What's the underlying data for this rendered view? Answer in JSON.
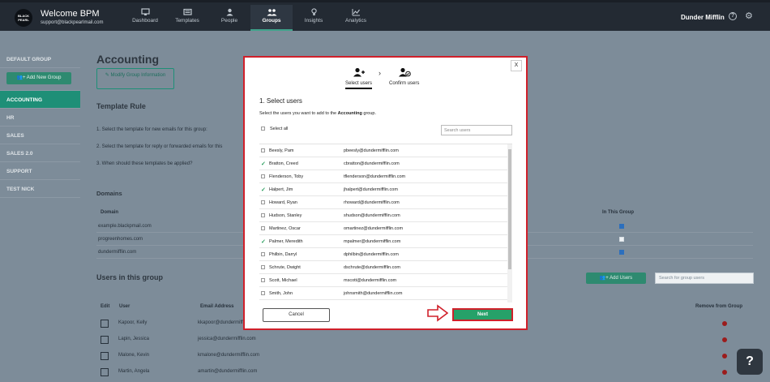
{
  "app": {
    "logo_text": "BLACK PEARL",
    "title": "Welcome BPM",
    "email": "support@blackpearlmail.com",
    "company": "Dunder Mifflin"
  },
  "nav": [
    {
      "label": "Dashboard",
      "icon": "monitor-icon",
      "active": false
    },
    {
      "label": "Templates",
      "icon": "templates-icon",
      "active": false
    },
    {
      "label": "People",
      "icon": "person-icon",
      "active": false
    },
    {
      "label": "Groups",
      "icon": "groups-icon",
      "active": true
    },
    {
      "label": "Insights",
      "icon": "lightbulb-icon",
      "active": false
    },
    {
      "label": "Analytics",
      "icon": "chart-icon",
      "active": false
    }
  ],
  "sidebar": {
    "default_group": "DEFAULT GROUP",
    "add_group": "Add New Group",
    "items": [
      "ACCOUNTING",
      "HR",
      "SALES",
      "SALES 2.0",
      "SUPPORT",
      "TEST NICK"
    ]
  },
  "background": {
    "title": "Accounting",
    "modify_button": "Modify Group Information",
    "template_rule": "Template Rule",
    "rule1": "1. Select the template for new emails for this group:",
    "rule2": "2. Select the template for reply or forwarded emails for this",
    "rule3": "3. When should these templates be applied?",
    "domains_heading": "Domains",
    "domain_col": "Domain",
    "in_group_col": "In This Group",
    "domains": [
      {
        "name": "example.blackpmail.com",
        "checked": true
      },
      {
        "name": "progreenhomes.com",
        "checked": false
      },
      {
        "name": "dundermifflin.com",
        "checked": true
      }
    ],
    "users_heading": "Users in this group",
    "add_users": "Add Users",
    "search_placeholder": "Search for group users",
    "col_edit": "Edit",
    "col_user": "User",
    "col_email": "Email Address",
    "col_remove": "Remove from Group",
    "users": [
      {
        "name": "Kapoor, Kelly",
        "email": "kkapoor@dundermifflin.com"
      },
      {
        "name": "Lapin, Jessica",
        "email": "jessica@dundermifflin.com"
      },
      {
        "name": "Malone, Kevin",
        "email": "kmalone@dundermifflin.com"
      },
      {
        "name": "Martin, Angela",
        "email": "amartin@dundermifflin.com"
      }
    ]
  },
  "modal": {
    "close": "X",
    "step1": "Select users",
    "step2": "Confirm users",
    "heading": "1. Select users",
    "desc_prefix": "Select the users you want to add to the",
    "group_name": "Accounting",
    "desc_suffix": "group.",
    "select_all": "Select all",
    "search_placeholder": "Search users",
    "users": [
      {
        "name": "Beesly, Pam",
        "email": "pbeesly@dundermifflin.com",
        "checked": false
      },
      {
        "name": "Bratton, Creed",
        "email": "cbratton@dundermifflin.com",
        "checked": true
      },
      {
        "name": "Flenderson, Toby",
        "email": "tflenderson@dundermifflin.com",
        "checked": false
      },
      {
        "name": "Halpert, Jim",
        "email": "jhalpert@dundermifflin.com",
        "checked": true
      },
      {
        "name": "Howard, Ryan",
        "email": "rhoward@dundermifflin.com",
        "checked": false
      },
      {
        "name": "Hudson, Stanley",
        "email": "shudson@dundermifflin.com",
        "checked": false
      },
      {
        "name": "Martinez, Oscar",
        "email": "omartinez@dundermifflin.com",
        "checked": false
      },
      {
        "name": "Palmer, Meredith",
        "email": "mpalmer@dundermifflin.com",
        "checked": true
      },
      {
        "name": "Philbin, Darryl",
        "email": "dphilbin@dundermifflin.com",
        "checked": false
      },
      {
        "name": "Schrute, Dwight",
        "email": "dschrute@dundermifflin.com",
        "checked": false
      },
      {
        "name": "Scott, Michael",
        "email": "mscott@dundermifflin.com",
        "checked": false
      },
      {
        "name": "Smith, John",
        "email": "johnsmith@dundermifflin.com",
        "checked": false
      }
    ],
    "cancel": "Cancel",
    "next": "Next"
  },
  "help_button": "?"
}
